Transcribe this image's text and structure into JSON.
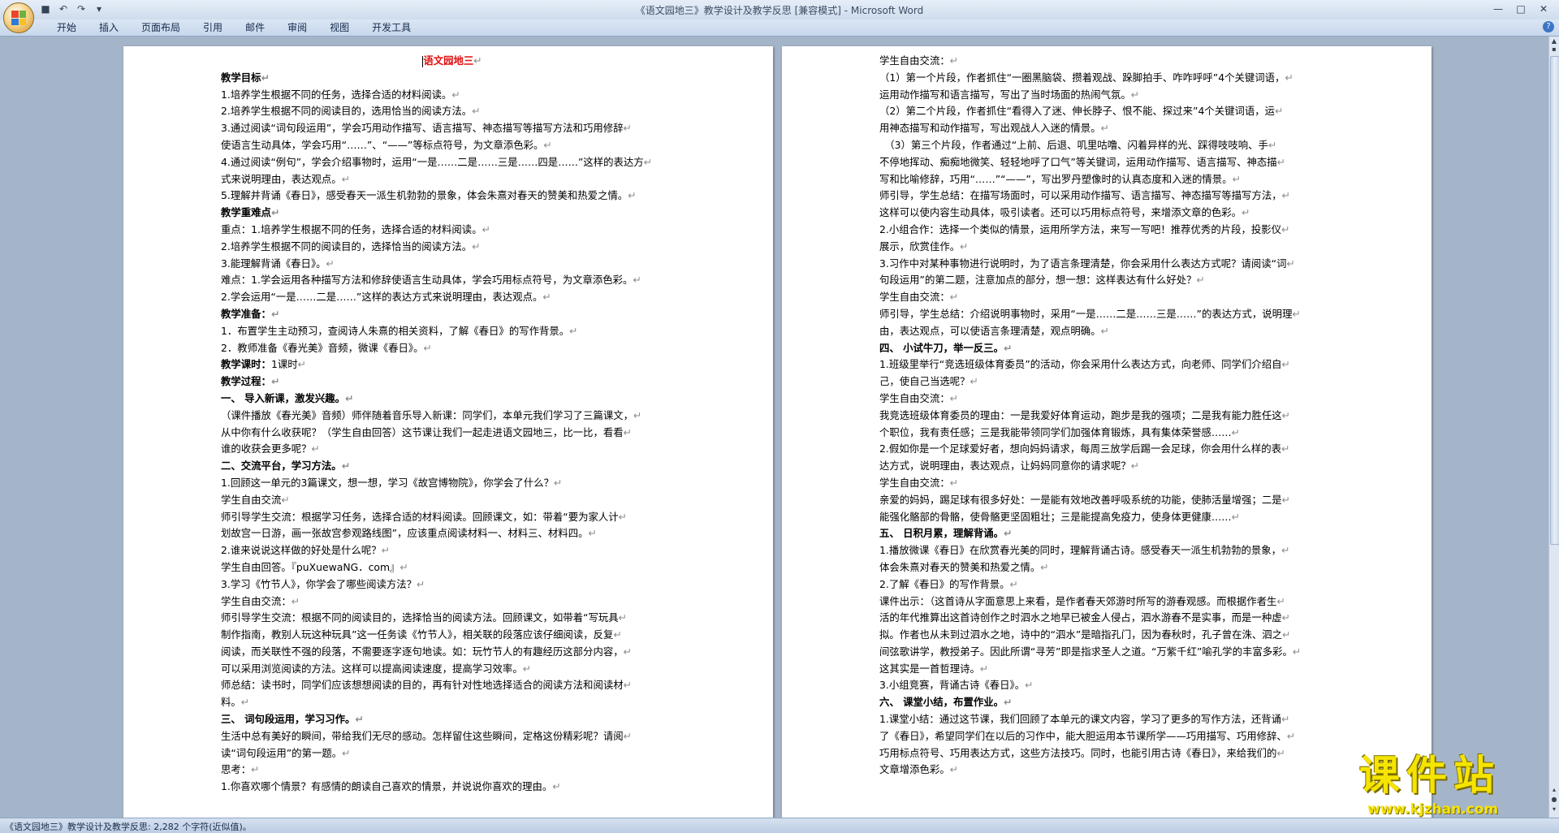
{
  "window": {
    "title": "《语文园地三》教学设计及教学反思 [兼容模式] - Microsoft Word"
  },
  "quick_access": [
    {
      "name": "save-icon",
      "glyph": "■"
    },
    {
      "name": "undo-icon",
      "glyph": "↶"
    },
    {
      "name": "redo-icon",
      "glyph": "↷"
    },
    {
      "name": "customize-icon",
      "glyph": "▾"
    }
  ],
  "window_controls": {
    "minimize": "—",
    "maximize": "□",
    "close": "✕"
  },
  "ribbon": {
    "tabs": [
      "开始",
      "插入",
      "页面布局",
      "引用",
      "邮件",
      "审阅",
      "视图",
      "开发工具"
    ],
    "help": "?"
  },
  "left_page": [
    {
      "t": "语文园地三",
      "s": "title"
    },
    {
      "t": "教学目标",
      "s": "b"
    },
    {
      "t": "1.培养学生根据不同的任务，选择合适的材料阅读。"
    },
    {
      "t": "2.培养学生根据不同的阅读目的，选用恰当的阅读方法。"
    },
    {
      "t": "3.通过阅读“词句段运用”，学会巧用动作描写、语言描写、神态描写等描写方法和巧用修辞"
    },
    {
      "t": "使语言生动具体，学会巧用“……”、“——”等标点符号，为文章添色彩。"
    },
    {
      "t": "4.通过阅读“例句”，学会介绍事物时，运用“一是……二是……三是……四是……”这样的表达方"
    },
    {
      "t": "式来说明理由，表达观点。"
    },
    {
      "t": "5.理解并背诵《春日》，感受春天一派生机勃勃的景象，体会朱熹对春天的赞美和热爱之情。"
    },
    {
      "t": "教学重难点",
      "s": "b"
    },
    {
      "t": "重点：1.培养学生根据不同的任务，选择合适的材料阅读。"
    },
    {
      "t": "2.培养学生根据不同的阅读目的，选择恰当的阅读方法。"
    },
    {
      "t": "3.能理解背诵《春日》。"
    },
    {
      "t": "难点：1.学会运用各种描写方法和修辞使语言生动具体，学会巧用标点符号，为文章添色彩。"
    },
    {
      "t": "2.学会运用“一是……二是……”这样的表达方式来说明理由，表达观点。"
    },
    {
      "t": "教学准备：",
      "s": "b"
    },
    {
      "t": "1．布置学生主动预习，查阅诗人朱熹的相关资料，了解《春日》的写作背景。"
    },
    {
      "t": "2．教师准备《春光美》音频，微课《春日》。"
    },
    {
      "t": "教学课时：",
      "t2": "1课时",
      "s": "mix"
    },
    {
      "t": "教学过程：",
      "s": "b"
    },
    {
      "t": "一、 导入新课，激发兴趣。",
      "s": "b"
    },
    {
      "t": "（课件播放《春光美》音频）师伴随着音乐导入新课：同学们，本单元我们学习了三篇课文，"
    },
    {
      "t": "从中你有什么收获呢？（学生自由回答）这节课让我们一起走进语文园地三，比一比，看看"
    },
    {
      "t": "谁的收获会更多呢？"
    },
    {
      "t": "二、交流平台，学习方法。",
      "s": "b"
    },
    {
      "t": "1.回顾这一单元的3篇课文，想一想，学习《故宫博物院》，你学会了什么？"
    },
    {
      "t": "学生自由交流"
    },
    {
      "t": "师引导学生交流：根据学习任务，选择合适的材料阅读。回顾课文，如：带着“要为家人计"
    },
    {
      "t": "划故宫一日游，画一张故宫参观路线图”，应该重点阅读材料一、材料三、材料四。"
    },
    {
      "t": "2.谁来说说这样做的好处是什么呢？"
    },
    {
      "t": "学生自由回答。『puXuewaNG．com』"
    },
    {
      "t": "3.学习《竹节人》，你学会了哪些阅读方法？"
    },
    {
      "t": "学生自由交流："
    },
    {
      "t": "师引导学生交流：根据不同的阅读目的，选择恰当的阅读方法。回顾课文，如带着“写玩具"
    },
    {
      "t": "制作指南，教别人玩这种玩具”这一任务读《竹节人》，相关联的段落应该仔细阅读，反复"
    },
    {
      "t": "阅读，而关联性不强的段落，不需要逐字逐句地读。如：玩竹节人的有趣经历这部分内容，"
    },
    {
      "t": "可以采用浏览阅读的方法。这样可以提高阅读速度，提高学习效率。"
    },
    {
      "t": "师总结：读书时，同学们应该想想阅读的目的，再有针对性地选择适合的阅读方法和阅读材"
    },
    {
      "t": "料。"
    },
    {
      "t": "三、 词句段运用，学习习作。",
      "s": "b"
    },
    {
      "t": "生活中总有美好的瞬间，带给我们无尽的感动。怎样留住这些瞬间，定格这份精彩呢？请阅"
    },
    {
      "t": "读“词句段运用”的第一题。"
    },
    {
      "t": "思考："
    },
    {
      "t": "1.你喜欢哪个情景？有感情的朗读自己喜欢的情景，并说说你喜欢的理由。"
    }
  ],
  "right_page": [
    {
      "t": "学生自由交流："
    },
    {
      "t": "（1）第一个片段，作者抓住“一圈黑脑袋、攒着观战、跺脚拍手、咋咋呼呼”4个关键词语，"
    },
    {
      "t": "运用动作描写和语言描写，写出了当时场面的热闹气氛。"
    },
    {
      "t": "（2）第二个片段，作者抓住“看得入了迷、伸长脖子、恨不能、探过来”4个关键词语，运"
    },
    {
      "t": "用神态描写和动作描写，写出观战人入迷的情景。"
    },
    {
      "t": "　（3）第三个片段，作者通过“上前、后退、叽里咕噜、闪着异样的光、踩得吱吱响、手"
    },
    {
      "t": "不停地挥动、痴痴地微笑、轻轻地呼了口气”等关键词，运用动作描写、语言描写、神态描"
    },
    {
      "t": "写和比喻修辞，巧用“……”“——”，写出罗丹塑像时的认真态度和入迷的情景。"
    },
    {
      "t": "师引导，学生总结：在描写场面时，可以采用动作描写、语言描写、神态描写等描写方法，"
    },
    {
      "t": "这样可以使内容生动具体，吸引读者。还可以巧用标点符号，来增添文章的色彩。"
    },
    {
      "t": "2.小组合作：选择一个类似的情景，运用所学方法，来写一写吧！推荐优秀的片段，投影仪"
    },
    {
      "t": "展示，欣赏佳作。"
    },
    {
      "t": "3.习作中对某种事物进行说明时，为了语言条理清楚，你会采用什么表达方式呢？请阅读“词"
    },
    {
      "t": "句段运用”的第二题，注意加点的部分，想一想：这样表达有什么好处？"
    },
    {
      "t": "学生自由交流："
    },
    {
      "t": "师引导，学生总结：介绍说明事物时，采用“一是……二是……三是……”的表达方式，说明理"
    },
    {
      "t": "由，表达观点，可以使语言条理清楚，观点明确。"
    },
    {
      "t": "四、 小试牛刀，举一反三。",
      "s": "b"
    },
    {
      "t": "1.班级里举行“竞选班级体育委员”的活动，你会采用什么表达方式，向老师、同学们介绍自"
    },
    {
      "t": "己，使自己当选呢？"
    },
    {
      "t": "学生自由交流："
    },
    {
      "t": "我竞选班级体育委员的理由：一是我爱好体育运动，跑步是我的强项；二是我有能力胜任这"
    },
    {
      "t": "个职位，我有责任感；三是我能带领同学们加强体育锻炼，具有集体荣誉感……"
    },
    {
      "t": "2.假如你是一个足球爱好者，想向妈妈请求，每周三放学后踢一会足球，你会用什么样的表"
    },
    {
      "t": "达方式，说明理由，表达观点，让妈妈同意你的请求呢？"
    },
    {
      "t": "学生自由交流："
    },
    {
      "t": "亲爱的妈妈，踢足球有很多好处：一是能有效地改善呼吸系统的功能，使肺活量增强；二是"
    },
    {
      "t": "能强化骼部的骨骼，使骨骼更坚固粗壮；三是能提高免疫力，使身体更健康……"
    },
    {
      "t": "五、 日积月累，理解背诵。",
      "s": "b"
    },
    {
      "t": "1.播放微课《春日》在欣赏春光美的同时，理解背诵古诗。感受春天一派生机勃勃的景象，"
    },
    {
      "t": "体会朱熹对春天的赞美和热爱之情。"
    },
    {
      "t": "2.了解《春日》的写作背景。"
    },
    {
      "t": "课件出示：（这首诗从字面意思上来看，是作者春天郊游时所写的游春观感。而根据作者生"
    },
    {
      "t": "活的年代推算出这首诗创作之时泗水之地早已被金人侵占，泗水游春不是实事，而是一种虚"
    },
    {
      "t": "拟。作者也从未到过泗水之地，诗中的“泗水”是暗指孔门，因为春秋时，孔子曾在洙、泗之"
    },
    {
      "t": "间弦歌讲学，教授弟子。因此所谓“寻芳”即是指求圣人之道。“万紫千红”喻孔学的丰富多彩。"
    },
    {
      "t": "这其实是一首哲理诗。"
    },
    {
      "t": "3.小组竞赛，背诵古诗《春日》。"
    },
    {
      "t": "六、 课堂小结，布置作业。",
      "s": "b"
    },
    {
      "t": "1.课堂小结：通过这节课，我们回顾了本单元的课文内容，学习了更多的写作方法，还背诵"
    },
    {
      "t": "了《春日》，希望同学们在以后的习作中，能大胆运用本节课所学——巧用描写、巧用修辞、"
    },
    {
      "t": "巧用标点符号、巧用表达方式，这些方法技巧。同时，也能引用古诗《春日》，来给我们的"
    },
    {
      "t": "文章增添色彩。"
    }
  ],
  "paragraph_mark": "↵",
  "status": {
    "text": "《语文园地三》教学设计及教学反思: 2,282 个字符(近似值)。"
  },
  "watermark": {
    "title": "课件站",
    "url": "www.kjzhan.com"
  },
  "colors": {
    "title_red": "#e01010",
    "watermark_yellow": "#f5e400"
  }
}
